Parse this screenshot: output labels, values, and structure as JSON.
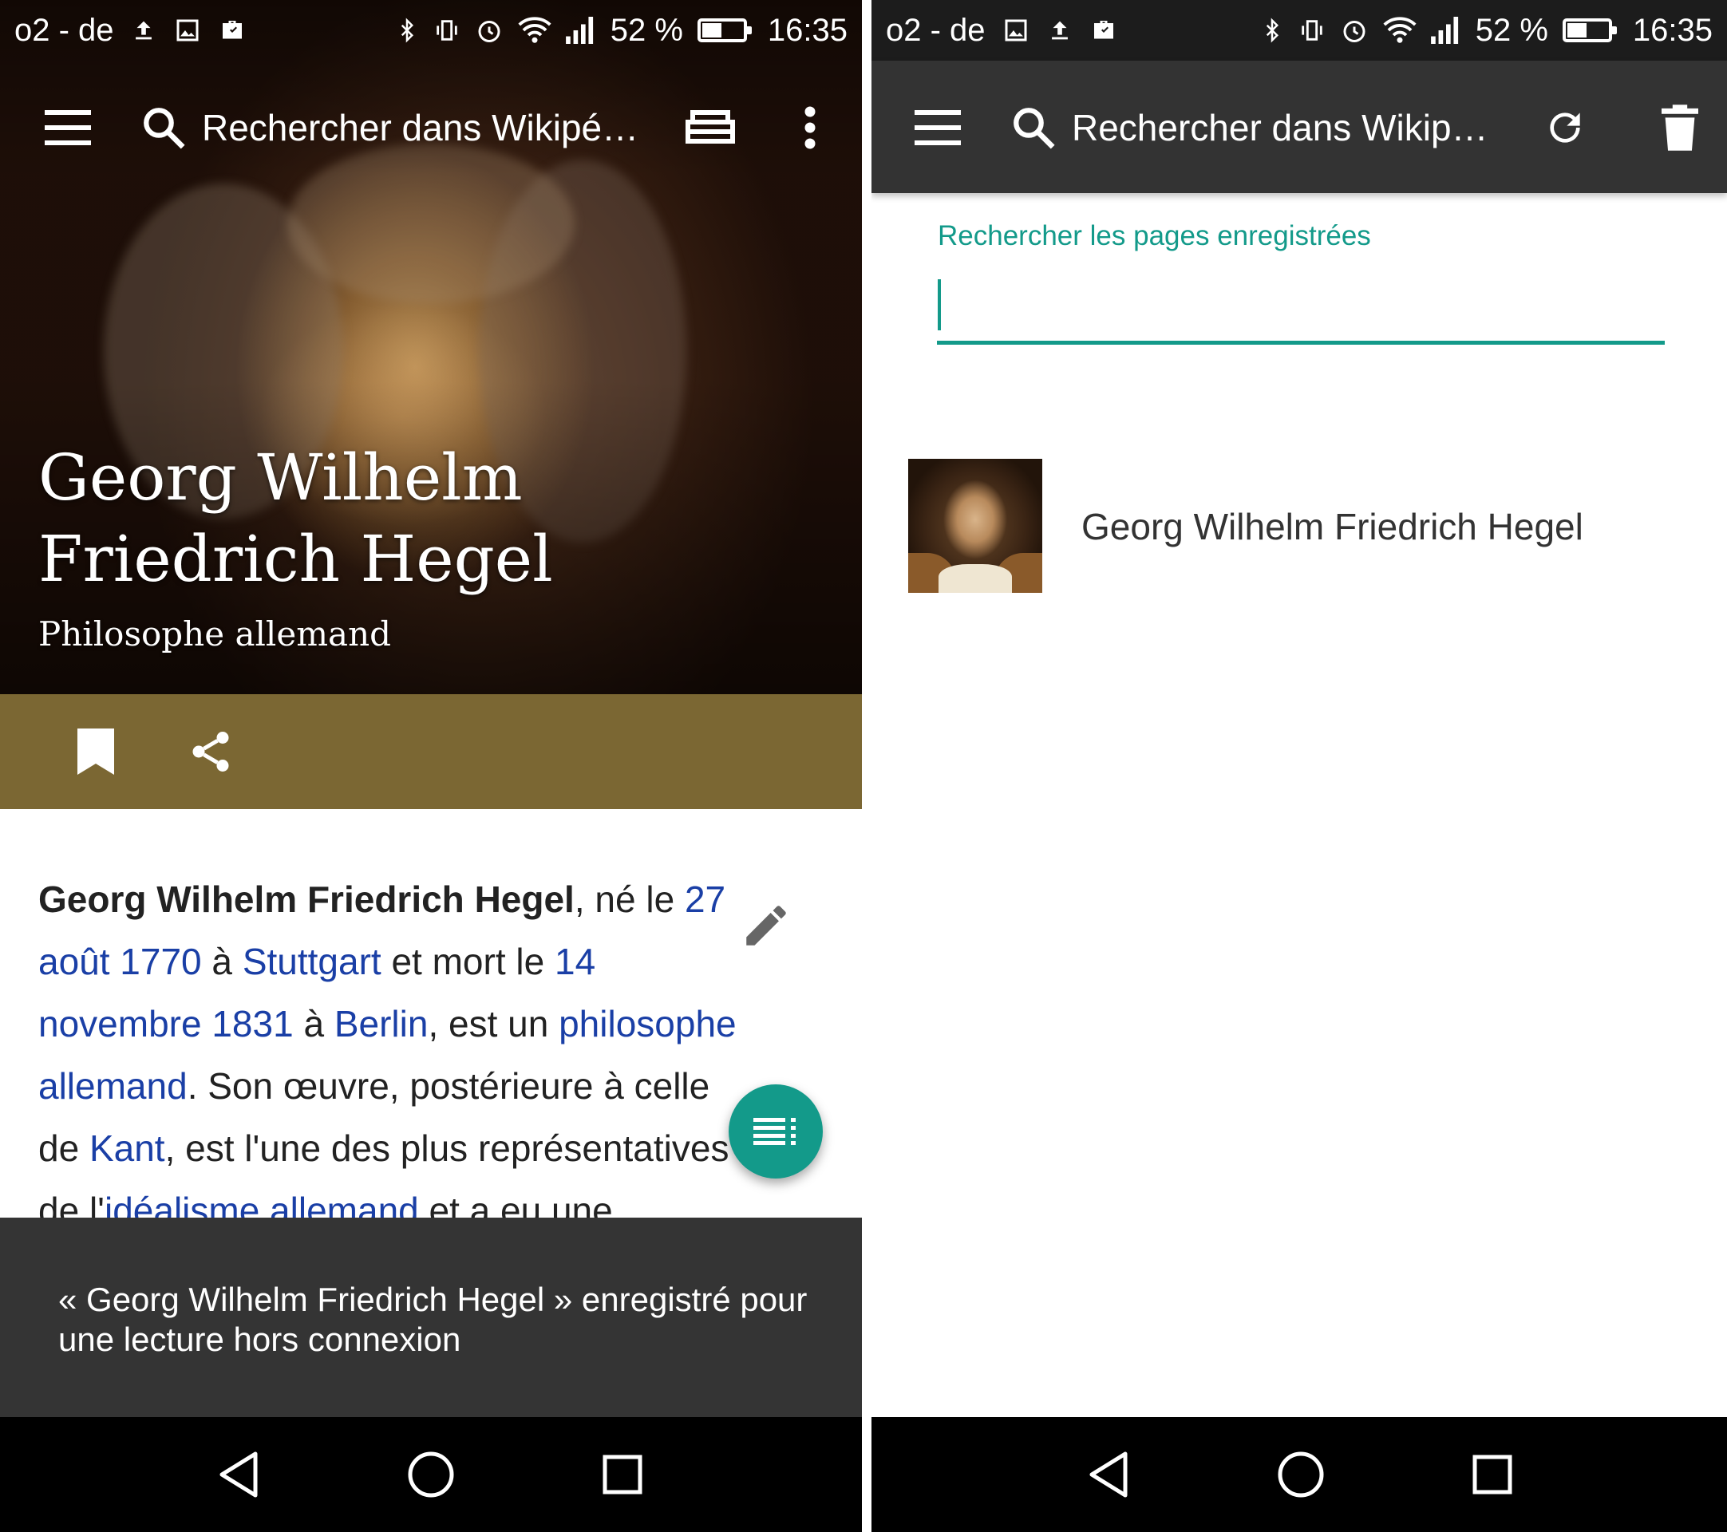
{
  "status_bar": {
    "carrier": "o2 - de",
    "battery_percent_label": "52 %",
    "battery_level": 0.52,
    "time": "16:35"
  },
  "left_screen": {
    "toolbar": {
      "search_placeholder": "Rechercher dans Wikipé…",
      "icons": [
        "menu-icon",
        "search-icon",
        "reading-lists-icon",
        "more-vert-icon"
      ]
    },
    "hero": {
      "title": "Georg Wilhelm Friedrich Hegel",
      "subtitle": "Philosophe allemand"
    },
    "action_bar": {
      "icons": [
        "bookmark-icon",
        "share-icon"
      ]
    },
    "article": {
      "name_bold": "Georg Wilhelm Friedrich Hegel",
      "t1": ", né le ",
      "link_birth_date": "27 août 1770",
      "t2": " à ",
      "link_birth_place": "Stuttgart",
      "t3": " et mort le ",
      "link_death_date": "14 novembre 1831",
      "t4": " à ",
      "link_death_place": "Berlin",
      "t5": ", est un ",
      "link_philosopher": "philosophe allemand",
      "t6": ". Son œuvre, postérieure à celle de ",
      "link_kant": "Kant",
      "t7": ", est l'une des plus représentatives de ",
      "t8": "l'",
      "link_idealism": "idéalisme allemand",
      "t9": " et a eu une influence"
    },
    "snackbar": "« Georg Wilhelm Friedrich Hegel » enregistré pour une lecture hors connexion"
  },
  "right_screen": {
    "toolbar": {
      "search_placeholder": "Rechercher dans Wikip…",
      "icons": [
        "menu-icon",
        "search-icon",
        "refresh-icon",
        "delete-icon"
      ]
    },
    "search_field": {
      "label": "Rechercher les pages enregistrées",
      "value": ""
    },
    "saved_pages": [
      {
        "title": "Georg Wilhelm Friedrich Hegel"
      }
    ]
  },
  "nav_bar": {
    "icons": [
      "back-icon",
      "home-icon",
      "recents-icon"
    ]
  },
  "colors": {
    "accent": "#139a8a",
    "link": "#1a3fa6",
    "action_bar": "#7b6733",
    "app_bar_dark": "#333333",
    "snackbar": "#343434"
  }
}
